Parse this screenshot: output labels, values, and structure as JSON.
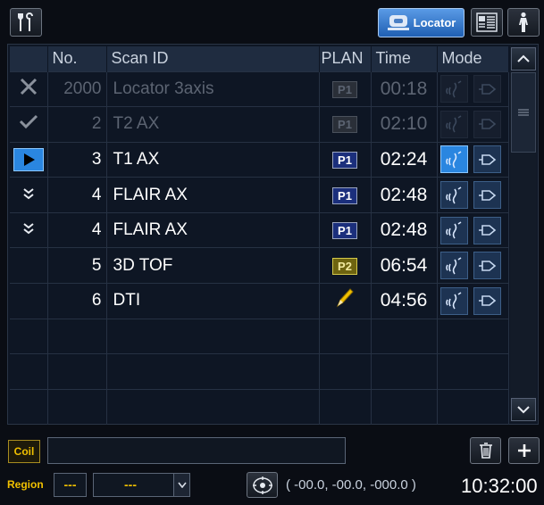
{
  "toolbar": {
    "tools_icon": "tools-icon",
    "locator_label": "Locator",
    "locator_icon": "scanner-icon",
    "layout_icon": "layout-icon",
    "patient_icon": "patient-icon"
  },
  "table": {
    "headers": {
      "no": "No.",
      "scan_id": "Scan ID",
      "plan": "PLAN",
      "time": "Time",
      "mode": "Mode"
    },
    "rows": [
      {
        "status": "done-x",
        "no": "2000",
        "scan_id": "Locator 3axis",
        "plan": "P1",
        "time": "00:18",
        "state": "dim"
      },
      {
        "status": "done-check",
        "no": "2",
        "scan_id": "T2 AX",
        "plan": "P1",
        "time": "02:10",
        "state": "dim"
      },
      {
        "status": "current",
        "no": "3",
        "scan_id": "T1 AX",
        "plan": "P1",
        "time": "02:24",
        "state": "current"
      },
      {
        "status": "queued",
        "no": "4",
        "scan_id": "FLAIR AX",
        "plan": "P1",
        "time": "02:48",
        "state": "normal"
      },
      {
        "status": "queued",
        "no": "4",
        "scan_id": "FLAIR AX",
        "plan": "P1",
        "time": "02:48",
        "state": "normal"
      },
      {
        "status": "",
        "no": "5",
        "scan_id": "3D TOF",
        "plan": "P2",
        "time": "06:54",
        "state": "normal"
      },
      {
        "status": "",
        "no": "6",
        "scan_id": "DTI",
        "plan": "pencil",
        "time": "04:56",
        "state": "normal"
      }
    ],
    "empty_rows": 3
  },
  "bottom": {
    "coil_label": "Coil",
    "coil_value": "",
    "region_label": "Region",
    "region_value": "---",
    "region_select_value": "---",
    "coords": "( -00.0,  -00.0,  -000.0 )",
    "clock": "10:32:00"
  },
  "colors": {
    "accent": "#2a86e0",
    "background": "#0e1624",
    "label_yellow": "#f0c000",
    "p2_badge": "#6e6410"
  }
}
